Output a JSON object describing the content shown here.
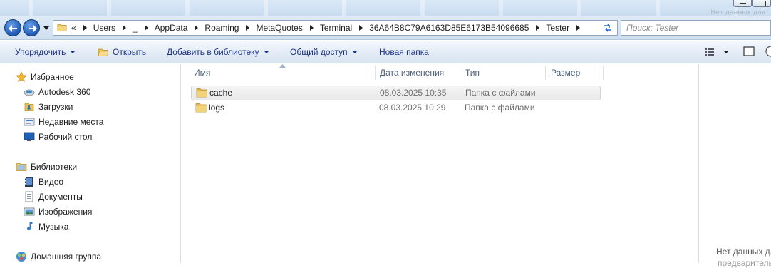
{
  "title_bar": {
    "faint_text": "Нет данных для"
  },
  "address": {
    "crumbs": [
      "Users",
      "_",
      "AppData",
      "Roaming",
      "MetaQuotes",
      "Terminal",
      "36A64B8C79A6163D85E6173B54096685",
      "Tester"
    ],
    "overflow": "«"
  },
  "search": {
    "placeholder": "Поиск: Tester"
  },
  "toolbar": {
    "organize": "Упорядочить",
    "open": "Открыть",
    "add_to_library": "Добавить в библиотеку",
    "share": "Общий доступ",
    "new_folder": "Новая папка"
  },
  "nav": {
    "favorites": {
      "label": "Избранное",
      "items": [
        {
          "label": "Autodesk 360",
          "icon": "cloud-drive-icon"
        },
        {
          "label": "Загрузки",
          "icon": "downloads-folder-icon"
        },
        {
          "label": "Недавние места",
          "icon": "recent-places-icon"
        },
        {
          "label": "Рабочий стол",
          "icon": "desktop-icon"
        }
      ]
    },
    "libraries": {
      "label": "Библиотеки",
      "items": [
        {
          "label": "Видео",
          "icon": "video-library-icon"
        },
        {
          "label": "Документы",
          "icon": "documents-library-icon"
        },
        {
          "label": "Изображения",
          "icon": "pictures-library-icon"
        },
        {
          "label": "Музыка",
          "icon": "music-library-icon"
        }
      ]
    },
    "homegroup": {
      "label": "Домашняя группа"
    }
  },
  "columns": {
    "name": "Имя",
    "date": "Дата изменения",
    "type": "Тип",
    "size": "Размер"
  },
  "files": [
    {
      "name": "cache",
      "date": "08.03.2025 10:35",
      "type": "Папка с файлами",
      "size": ""
    },
    {
      "name": "logs",
      "date": "08.03.2025 10:29",
      "type": "Папка с файлами",
      "size": ""
    }
  ],
  "details": {
    "no_data": "Нет данных дл",
    "no_data_2": "предварительн"
  }
}
